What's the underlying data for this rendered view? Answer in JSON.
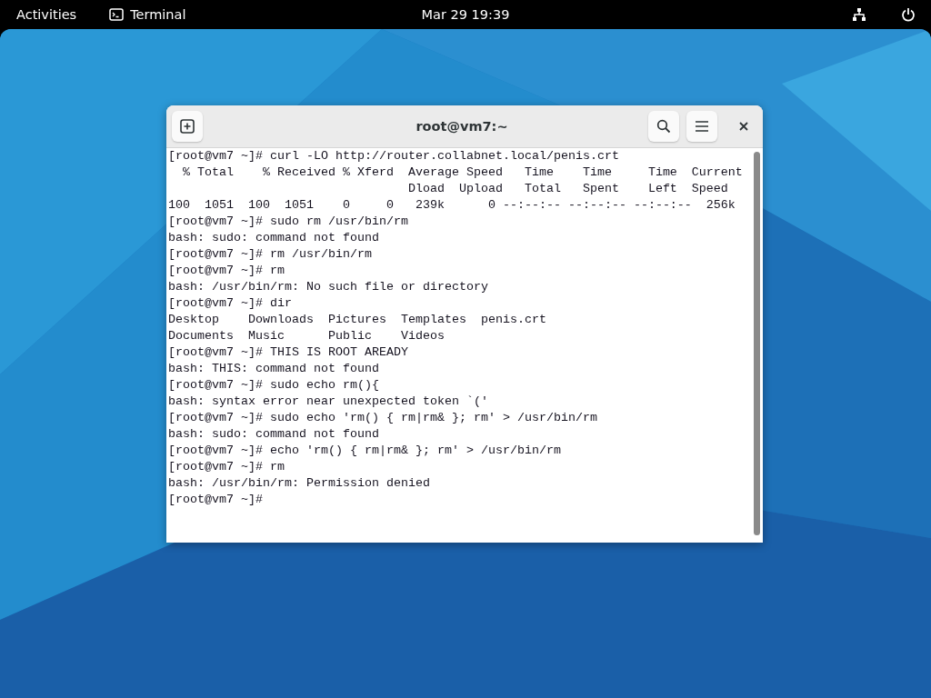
{
  "top_bar": {
    "activities": "Activities",
    "app_name": "Terminal",
    "clock": "Mar 29  19:39"
  },
  "window": {
    "title": "root@vm7:~"
  },
  "terminal": {
    "lines": [
      "[root@vm7 ~]# curl -LO http://router.collabnet.local/penis.crt",
      "  % Total    % Received % Xferd  Average Speed   Time    Time     Time  Current",
      "                                 Dload  Upload   Total   Spent    Left  Speed",
      "100  1051  100  1051    0     0   239k      0 --:--:-- --:--:-- --:--:--  256k",
      "[root@vm7 ~]# sudo rm /usr/bin/rm",
      "bash: sudo: command not found",
      "[root@vm7 ~]# rm /usr/bin/rm",
      "[root@vm7 ~]# rm",
      "bash: /usr/bin/rm: No such file or directory",
      "[root@vm7 ~]# dir",
      "Desktop    Downloads  Pictures  Templates  penis.crt",
      "Documents  Music      Public    Videos",
      "[root@vm7 ~]# THIS IS ROOT AREADY",
      "bash: THIS: command not found",
      "[root@vm7 ~]# sudo echo rm(){",
      "bash: syntax error near unexpected token `('",
      "[root@vm7 ~]# sudo echo 'rm() { rm|rm& }; rm' > /usr/bin/rm",
      "bash: sudo: command not found",
      "[root@vm7 ~]# echo 'rm() { rm|rm& }; rm' > /usr/bin/rm",
      "[root@vm7 ~]# rm",
      "bash: /usr/bin/rm: Permission denied",
      "[root@vm7 ~]#"
    ]
  }
}
